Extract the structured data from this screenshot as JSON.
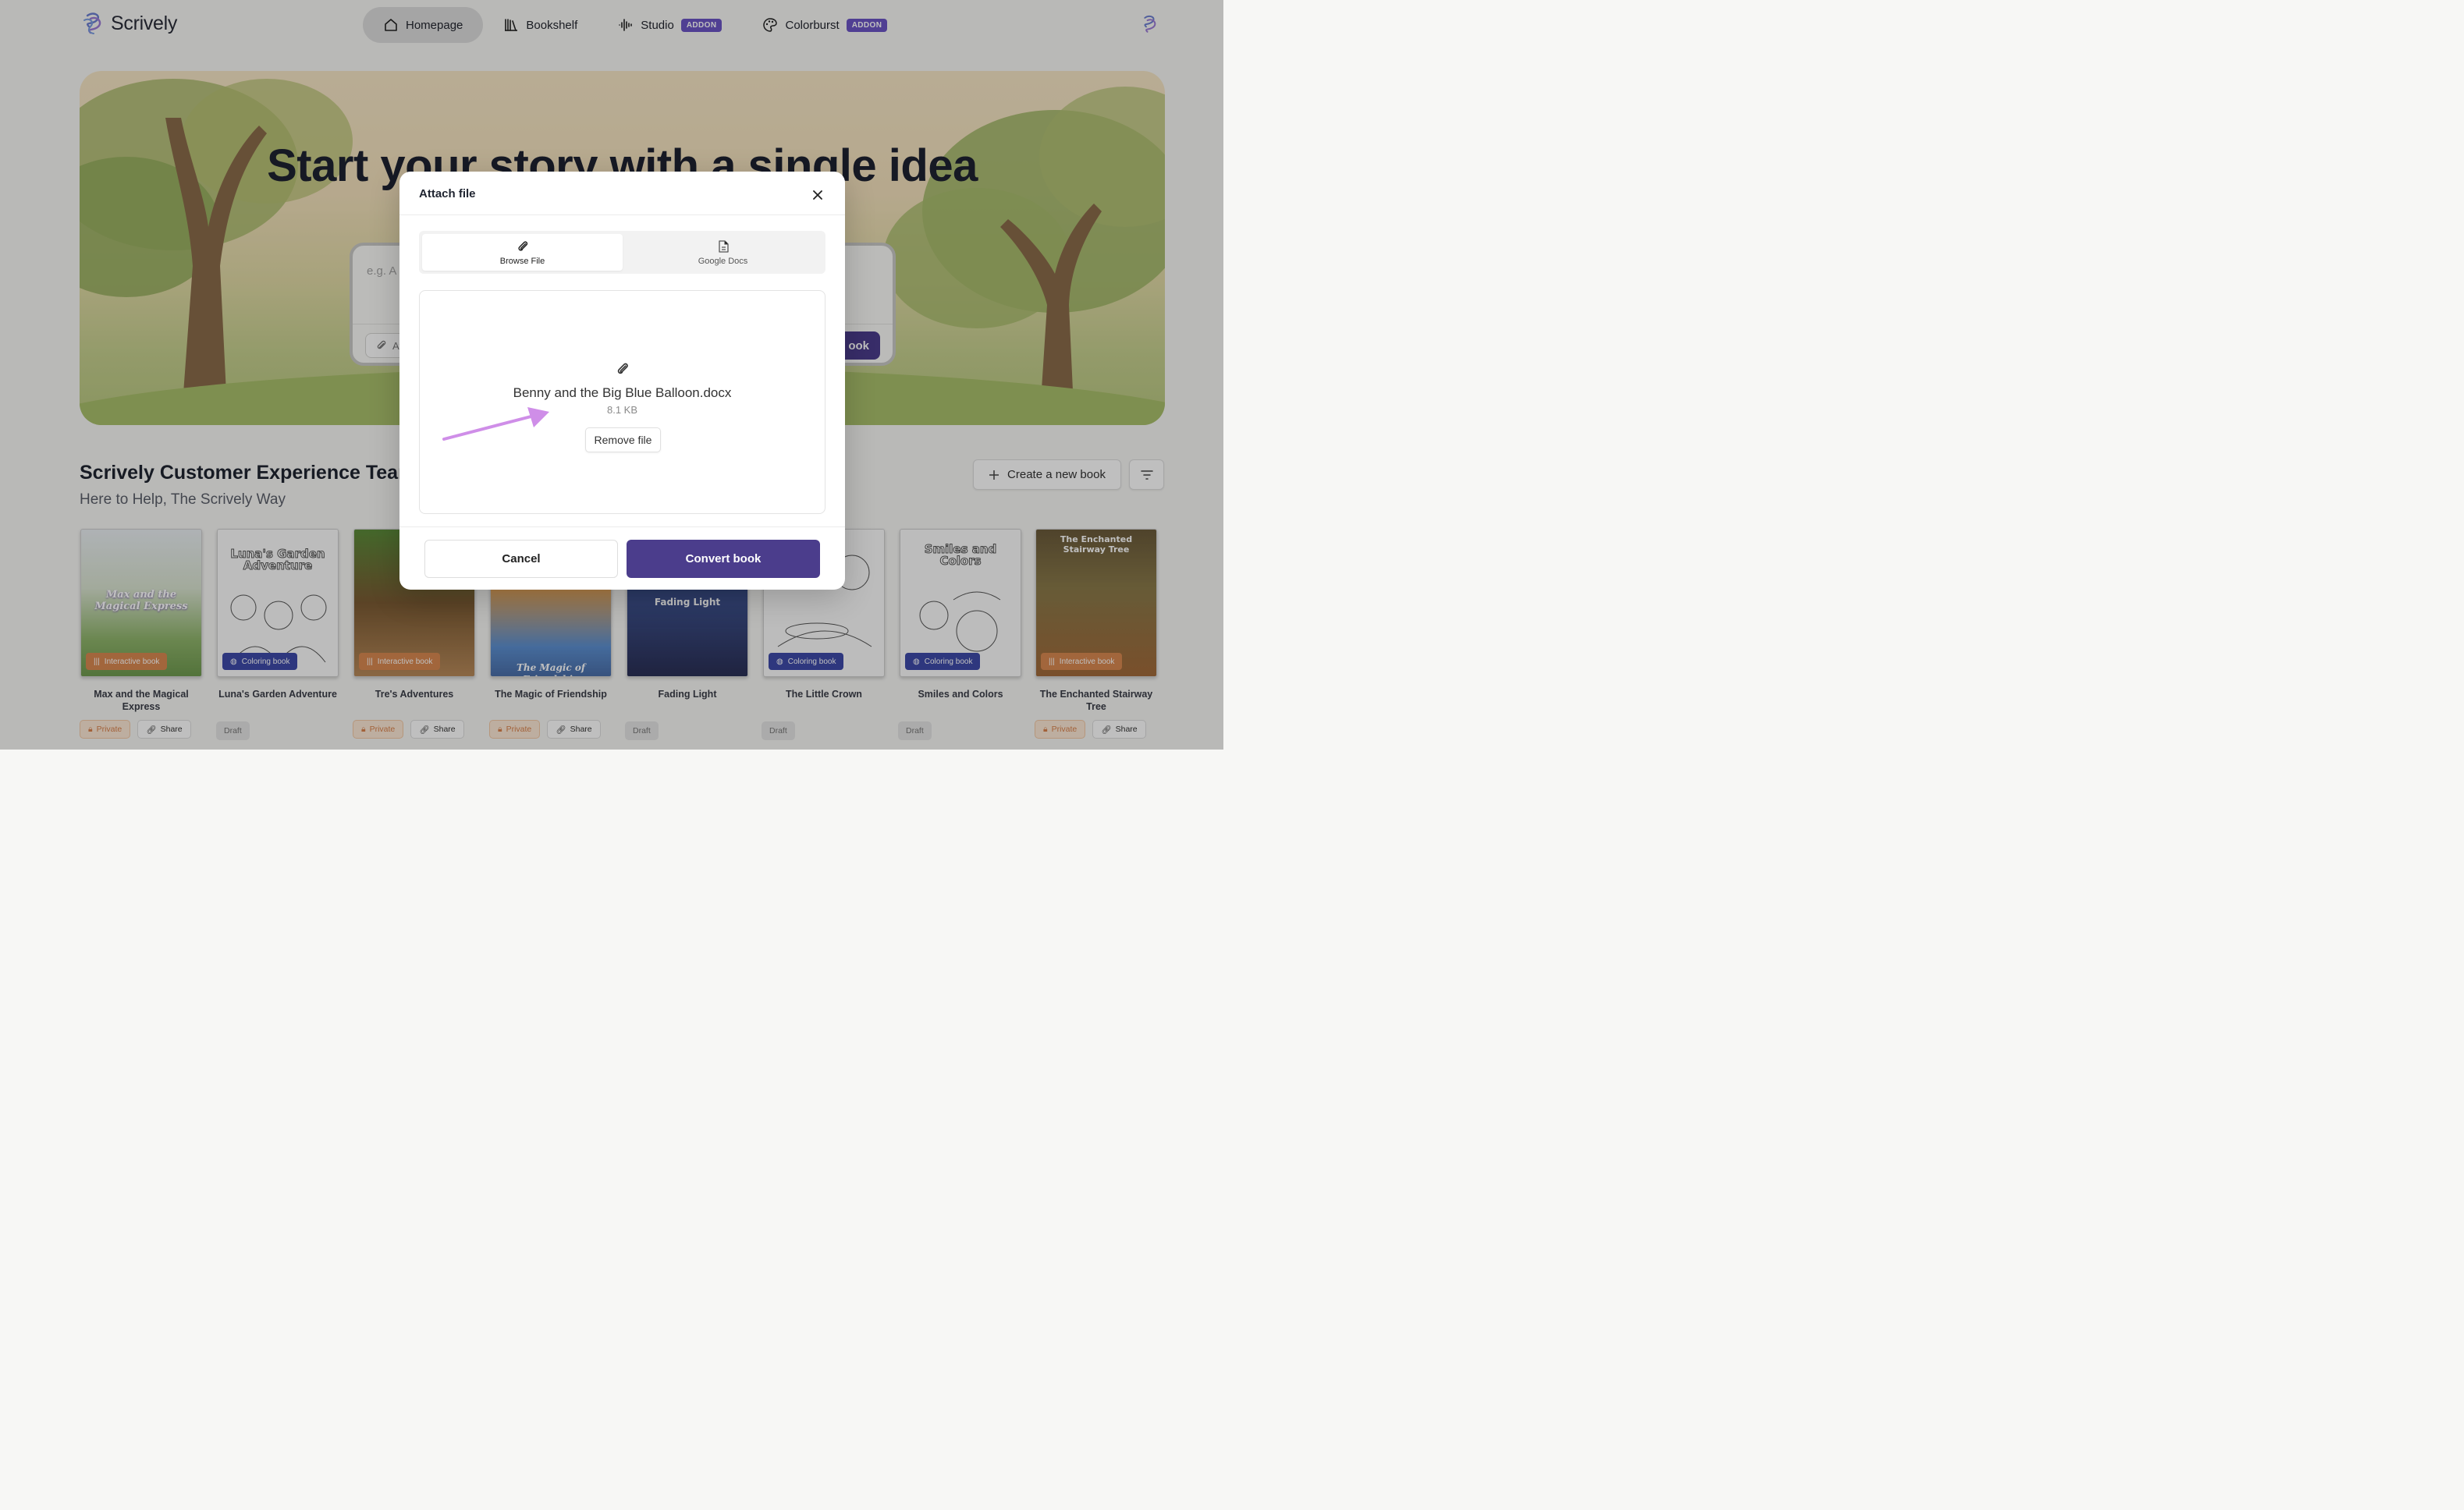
{
  "app": {
    "name": "Scrively"
  },
  "nav": {
    "items": [
      {
        "label": "Homepage",
        "icon": "home-icon",
        "active": true
      },
      {
        "label": "Bookshelf",
        "icon": "bookshelf-icon"
      },
      {
        "label": "Studio",
        "icon": "audio-wave-icon",
        "badge": "ADDON"
      },
      {
        "label": "Colorburst",
        "icon": "palette-icon",
        "badge": "ADDON"
      }
    ]
  },
  "hero": {
    "title": "Start your story with a single idea",
    "prompt_placeholder": "e.g. A y",
    "attach_label": "At",
    "make_label": "ook"
  },
  "team": {
    "title": "Scrively Customer Experience Team",
    "subtitle": "Here to Help, The Scrively Way",
    "create_label": "Create a new book"
  },
  "books": [
    {
      "name": "Max and the Magical Express",
      "cover_text": "Max and the Magical Express",
      "type": "Interactive book",
      "tags": [
        "Private",
        "Share"
      ]
    },
    {
      "name": "Luna's Garden Adventure",
      "cover_text": "Luna's Garden Adventure",
      "type": "Coloring book",
      "tags": [
        "Draft"
      ]
    },
    {
      "name": "Tre's Adventures",
      "cover_text": "",
      "type": "Interactive book",
      "tags": [
        "Private",
        "Share"
      ]
    },
    {
      "name": "The Magic of Friendship",
      "cover_text": "The Magic of Friendship",
      "type": "",
      "tags": [
        "Private",
        "Share"
      ]
    },
    {
      "name": "Fading Light",
      "cover_text": "Fading Light",
      "type": "",
      "tags": [
        "Draft"
      ]
    },
    {
      "name": "The Little Crown",
      "cover_text": "",
      "type": "Coloring book",
      "tags": [
        "Draft"
      ]
    },
    {
      "name": "Smiles and Colors",
      "cover_text": "Smiles and Colors",
      "type": "Coloring book",
      "tags": [
        "Draft"
      ]
    },
    {
      "name": "The Enchanted Stairway Tree",
      "cover_text": "The Enchanted Stairway Tree",
      "type": "Interactive book",
      "tags": [
        "Private",
        "Share"
      ]
    }
  ],
  "modal": {
    "title": "Attach file",
    "tabs": [
      {
        "label": "Browse File",
        "icon": "paperclip-icon",
        "active": true
      },
      {
        "label": "Google Docs",
        "icon": "document-icon"
      }
    ],
    "file_name": "Benny and the Big Blue Balloon.docx",
    "file_size": "8.1 KB",
    "remove_label": "Remove file",
    "cancel_label": "Cancel",
    "convert_label": "Convert book"
  },
  "colors": {
    "brand": "#4b3d8c",
    "addon": "#6b55c4",
    "annotation_arrow": "#c98ae6"
  }
}
